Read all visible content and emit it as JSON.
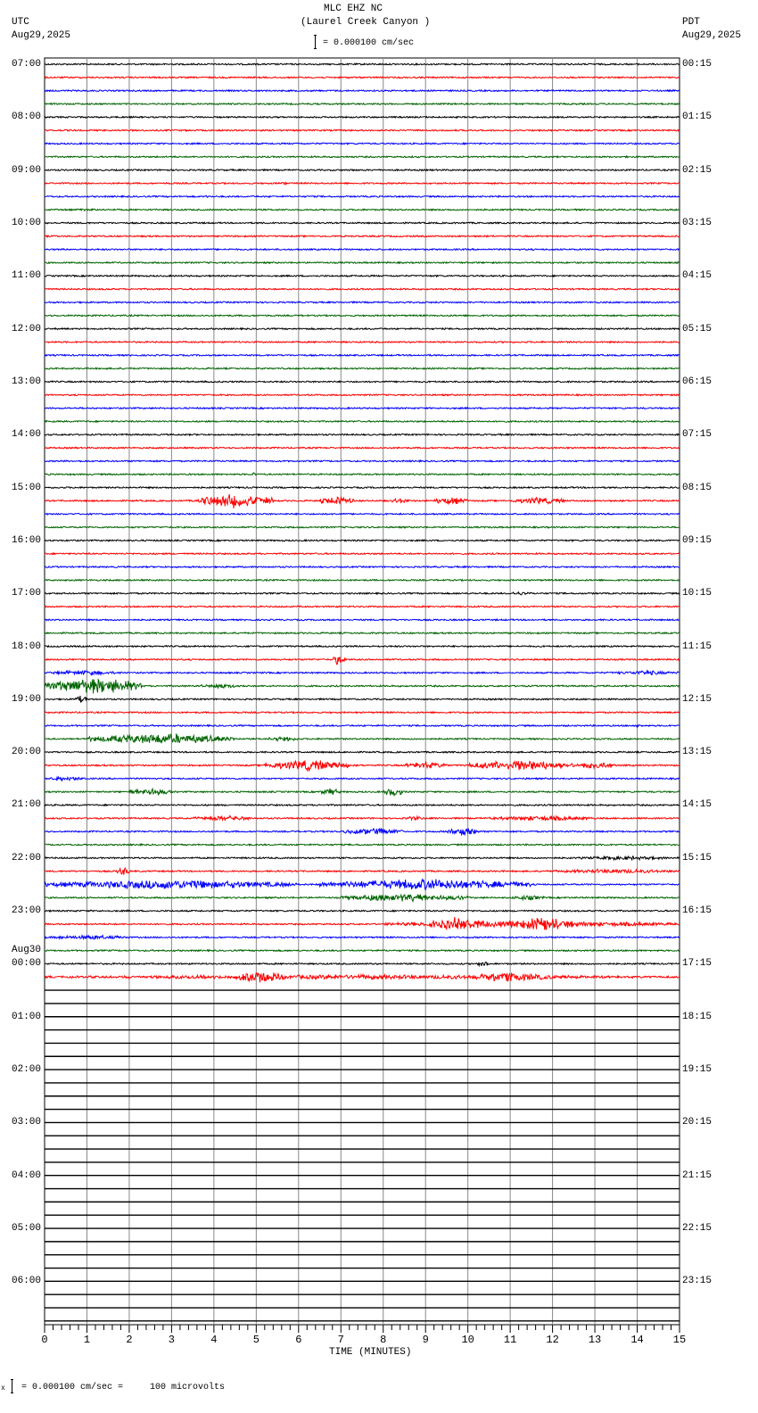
{
  "header": {
    "title": "MLC EHZ NC",
    "subtitle": "(Laurel Creek Canyon )",
    "scale_text": "= 0.000100 cm/sec",
    "left_tz": "UTC",
    "left_date": "Aug29,2025",
    "right_tz": "PDT",
    "right_date": "Aug29,2025"
  },
  "footer": {
    "scale_text": "= 0.000100 cm/sec =     100 microvolts",
    "marker": "x"
  },
  "chart_data": {
    "type": "line",
    "title": "MLC EHZ NC (Laurel Creek Canyon )",
    "xlabel": "TIME (MINUTES)",
    "xlim": [
      0,
      15
    ],
    "x_ticks": [
      "0",
      "1",
      "2",
      "3",
      "4",
      "5",
      "6",
      "7",
      "8",
      "9",
      "10",
      "11",
      "12",
      "13",
      "14",
      "15"
    ],
    "rows_total": 96,
    "rows_with_data": 70,
    "trace_colors": [
      "#000000",
      "#ff0000",
      "#0000ff",
      "#006400"
    ],
    "left_labels": [
      "07:00",
      "08:00",
      "09:00",
      "10:00",
      "11:00",
      "12:00",
      "13:00",
      "14:00",
      "15:00",
      "16:00",
      "17:00",
      "18:00",
      "19:00",
      "20:00",
      "21:00",
      "22:00",
      "23:00",
      "00:00",
      "01:00",
      "02:00",
      "03:00",
      "04:00",
      "05:00",
      "06:00"
    ],
    "date_change_label": "Aug30",
    "right_labels": [
      "00:15",
      "01:15",
      "02:15",
      "03:15",
      "04:15",
      "05:15",
      "06:15",
      "07:15",
      "08:15",
      "09:15",
      "10:15",
      "11:15",
      "12:15",
      "13:15",
      "14:15",
      "15:15",
      "16:15",
      "17:15",
      "18:15",
      "19:15",
      "20:15",
      "21:15",
      "22:15",
      "23:15"
    ],
    "events": [
      {
        "row": 8,
        "start": 7.1,
        "end": 7.4,
        "amp": 3
      },
      {
        "row": 9,
        "start": 5.5,
        "end": 5.9,
        "amp": 4
      },
      {
        "row": 10,
        "start": 3.7,
        "end": 3.9,
        "amp": 4
      },
      {
        "row": 11,
        "start": 0.3,
        "end": 1.5,
        "amp": 3
      },
      {
        "row": 31,
        "start": 4.9,
        "end": 5.0,
        "amp": 8
      },
      {
        "row": 33,
        "start": 3.6,
        "end": 5.4,
        "amp": 18
      },
      {
        "row": 33,
        "start": 6.5,
        "end": 7.3,
        "amp": 12
      },
      {
        "row": 33,
        "start": 8.2,
        "end": 8.6,
        "amp": 8
      },
      {
        "row": 33,
        "start": 9.2,
        "end": 10.0,
        "amp": 10
      },
      {
        "row": 33,
        "start": 11.0,
        "end": 12.3,
        "amp": 9
      },
      {
        "row": 40,
        "start": 11.0,
        "end": 11.5,
        "amp": 5
      },
      {
        "row": 45,
        "start": 6.8,
        "end": 7.1,
        "amp": 14
      },
      {
        "row": 46,
        "start": 0.0,
        "end": 2.0,
        "amp": 6
      },
      {
        "row": 46,
        "start": 13.3,
        "end": 15.0,
        "amp": 6
      },
      {
        "row": 47,
        "start": 0.0,
        "end": 2.3,
        "amp": 22
      },
      {
        "row": 47,
        "start": 3.6,
        "end": 4.7,
        "amp": 6
      },
      {
        "row": 48,
        "start": 0.7,
        "end": 1.0,
        "amp": 10
      },
      {
        "row": 50,
        "start": 13.9,
        "end": 14.1,
        "amp": 5
      },
      {
        "row": 51,
        "start": 1.0,
        "end": 4.5,
        "amp": 14
      },
      {
        "row": 51,
        "start": 5.2,
        "end": 6.0,
        "amp": 7
      },
      {
        "row": 53,
        "start": 5.2,
        "end": 7.2,
        "amp": 14
      },
      {
        "row": 53,
        "start": 8.5,
        "end": 9.5,
        "amp": 10
      },
      {
        "row": 53,
        "start": 10.0,
        "end": 12.5,
        "amp": 14
      },
      {
        "row": 53,
        "start": 12.5,
        "end": 13.5,
        "amp": 9
      },
      {
        "row": 54,
        "start": 0.0,
        "end": 1.0,
        "amp": 6
      },
      {
        "row": 55,
        "start": 2.0,
        "end": 3.0,
        "amp": 10
      },
      {
        "row": 55,
        "start": 6.5,
        "end": 7.0,
        "amp": 9
      },
      {
        "row": 55,
        "start": 8.0,
        "end": 8.5,
        "amp": 12
      },
      {
        "row": 57,
        "start": 3.5,
        "end": 5.0,
        "amp": 7
      },
      {
        "row": 57,
        "start": 8.5,
        "end": 9.0,
        "amp": 6
      },
      {
        "row": 57,
        "start": 10.5,
        "end": 13.0,
        "amp": 7
      },
      {
        "row": 58,
        "start": 7.0,
        "end": 8.5,
        "amp": 9
      },
      {
        "row": 58,
        "start": 9.5,
        "end": 10.3,
        "amp": 12
      },
      {
        "row": 60,
        "start": 12.5,
        "end": 15.0,
        "amp": 5
      },
      {
        "row": 61,
        "start": 1.7,
        "end": 2.0,
        "amp": 12
      },
      {
        "row": 61,
        "start": 12.0,
        "end": 15.0,
        "amp": 6
      },
      {
        "row": 62,
        "start": 0.0,
        "end": 6.0,
        "amp": 12
      },
      {
        "row": 62,
        "start": 6.5,
        "end": 11.5,
        "amp": 14
      },
      {
        "row": 63,
        "start": 7.0,
        "end": 10.0,
        "amp": 10
      },
      {
        "row": 63,
        "start": 11.0,
        "end": 11.8,
        "amp": 7
      },
      {
        "row": 65,
        "start": 8.0,
        "end": 15.0,
        "amp": 8
      },
      {
        "row": 65,
        "start": 9.0,
        "end": 10.5,
        "amp": 18
      },
      {
        "row": 65,
        "start": 11.0,
        "end": 12.5,
        "amp": 18
      },
      {
        "row": 66,
        "start": 0.0,
        "end": 2.0,
        "amp": 6
      },
      {
        "row": 68,
        "start": 10.2,
        "end": 10.5,
        "amp": 8
      },
      {
        "row": 69,
        "start": 0.0,
        "end": 15.0,
        "amp": 6
      },
      {
        "row": 69,
        "start": 4.5,
        "end": 5.7,
        "amp": 16
      },
      {
        "row": 69,
        "start": 10.0,
        "end": 12.0,
        "amp": 12
      }
    ]
  }
}
